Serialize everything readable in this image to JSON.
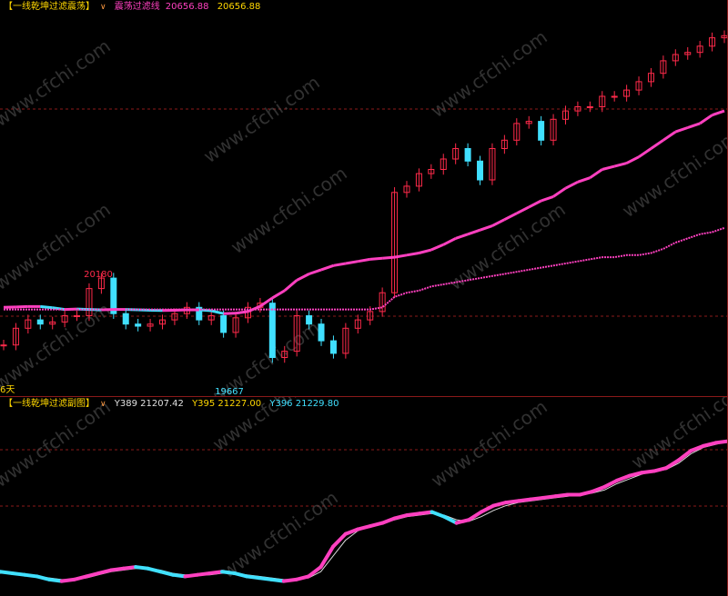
{
  "top": {
    "indicator_name": "【一线乾坤过滤震荡】",
    "line_label": "震荡过滤线",
    "line_value": "20656.88",
    "last_value": "20656.88",
    "high_label": "20180",
    "low_label": "19667",
    "period_label": "6天"
  },
  "bottom": {
    "indicator_name": "【一线乾坤过滤副图】",
    "y1": "Y389 21207.42",
    "y2": "Y395 21227.00",
    "y3": "Y396 21229.80"
  },
  "watermark": "www.cfchi.com",
  "colors": {
    "up": "#ff2a4a",
    "down": "#40e0ff",
    "filter_up": "#ff40c0",
    "filter_down": "#40e0ff",
    "ma": "#ff40c0",
    "grid": "#8b1a1a"
  },
  "chart_data": [
    {
      "type": "line",
      "ylim": [
        19550,
        21350
      ],
      "series": [
        {
          "name": "震荡过滤线",
          "values": [
            19940,
            19942,
            19944,
            19944,
            19938,
            19930,
            19932,
            19930,
            19928,
            19930,
            19930,
            19928,
            19926,
            19925,
            19926,
            19928,
            19928,
            19924,
            19910,
            19912,
            19920,
            19945,
            19985,
            20020,
            20070,
            20100,
            20120,
            20140,
            20150,
            20160,
            20170,
            20175,
            20180,
            20190,
            20200,
            20215,
            20240,
            20270,
            20290,
            20310,
            20330,
            20360,
            20390,
            20420,
            20450,
            20470,
            20510,
            20540,
            20560,
            20600,
            20615,
            20630,
            20660,
            20700,
            20740,
            20780,
            20800,
            20820,
            20860,
            20880
          ]
        },
        {
          "name": "close",
          "values": [
            19760,
            19840,
            19880,
            19860,
            19870,
            19900,
            19900,
            20030,
            20080,
            19910,
            19860,
            19850,
            19860,
            19880,
            19910,
            19940,
            19880,
            19900,
            19820,
            19890,
            19940,
            19960,
            19700,
            19730,
            19900,
            19860,
            19780,
            19720,
            19840,
            19880,
            19920,
            20010,
            20490,
            20520,
            20580,
            20600,
            20650,
            20700,
            20640,
            20550,
            20700,
            20740,
            20820,
            20830,
            20740,
            20840,
            20880,
            20900,
            20900,
            20950,
            20950,
            20980,
            21020,
            21060,
            21120,
            21150,
            21160,
            21190,
            21230,
            21240
          ]
        },
        {
          "name": "ma",
          "values": [
            19930,
            19930,
            19930,
            19930,
            19930,
            19930,
            19930,
            19930,
            19930,
            19930,
            19930,
            19930,
            19930,
            19930,
            19930,
            19930,
            19930,
            19930,
            19930,
            19930,
            19930,
            19930,
            19930,
            19930,
            19930,
            19930,
            19930,
            19930,
            19930,
            19930,
            19930,
            19940,
            19990,
            20010,
            20020,
            20040,
            20050,
            20060,
            20070,
            20080,
            20090,
            20100,
            20110,
            20120,
            20130,
            20140,
            20150,
            20160,
            20170,
            20180,
            20180,
            20190,
            20190,
            20200,
            20220,
            20250,
            20270,
            20290,
            20300,
            20320
          ]
        }
      ]
    },
    {
      "type": "line",
      "ylim": [
        0,
        10
      ],
      "series": [
        {
          "name": "main",
          "values": [
            1.2,
            1.1,
            1.0,
            0.9,
            0.7,
            0.6,
            0.7,
            0.9,
            1.1,
            1.3,
            1.4,
            1.5,
            1.4,
            1.2,
            1.0,
            0.9,
            1.0,
            1.1,
            1.2,
            1.1,
            0.9,
            0.8,
            0.7,
            0.6,
            0.7,
            0.9,
            1.5,
            2.8,
            3.6,
            3.9,
            4.1,
            4.3,
            4.6,
            4.8,
            4.9,
            5.0,
            4.7,
            4.3,
            4.5,
            5.0,
            5.4,
            5.6,
            5.7,
            5.8,
            5.9,
            6.0,
            6.1,
            6.1,
            6.3,
            6.6,
            7.0,
            7.3,
            7.5,
            7.6,
            7.8,
            8.3,
            8.9,
            9.2,
            9.4,
            9.5
          ]
        },
        {
          "name": "signal",
          "values": [
            1.1,
            1.1,
            1.0,
            0.9,
            0.8,
            0.7,
            0.7,
            0.8,
            1.0,
            1.2,
            1.3,
            1.4,
            1.4,
            1.3,
            1.1,
            1.0,
            1.0,
            1.0,
            1.1,
            1.1,
            1.0,
            0.9,
            0.8,
            0.7,
            0.7,
            0.8,
            1.2,
            2.2,
            3.2,
            3.8,
            4.1,
            4.3,
            4.5,
            4.7,
            4.8,
            4.9,
            4.8,
            4.5,
            4.4,
            4.7,
            5.1,
            5.4,
            5.6,
            5.7,
            5.8,
            5.9,
            6.0,
            6.1,
            6.2,
            6.4,
            6.8,
            7.1,
            7.4,
            7.6,
            7.7,
            8.1,
            8.7,
            9.1,
            9.3,
            9.5
          ]
        }
      ]
    }
  ]
}
